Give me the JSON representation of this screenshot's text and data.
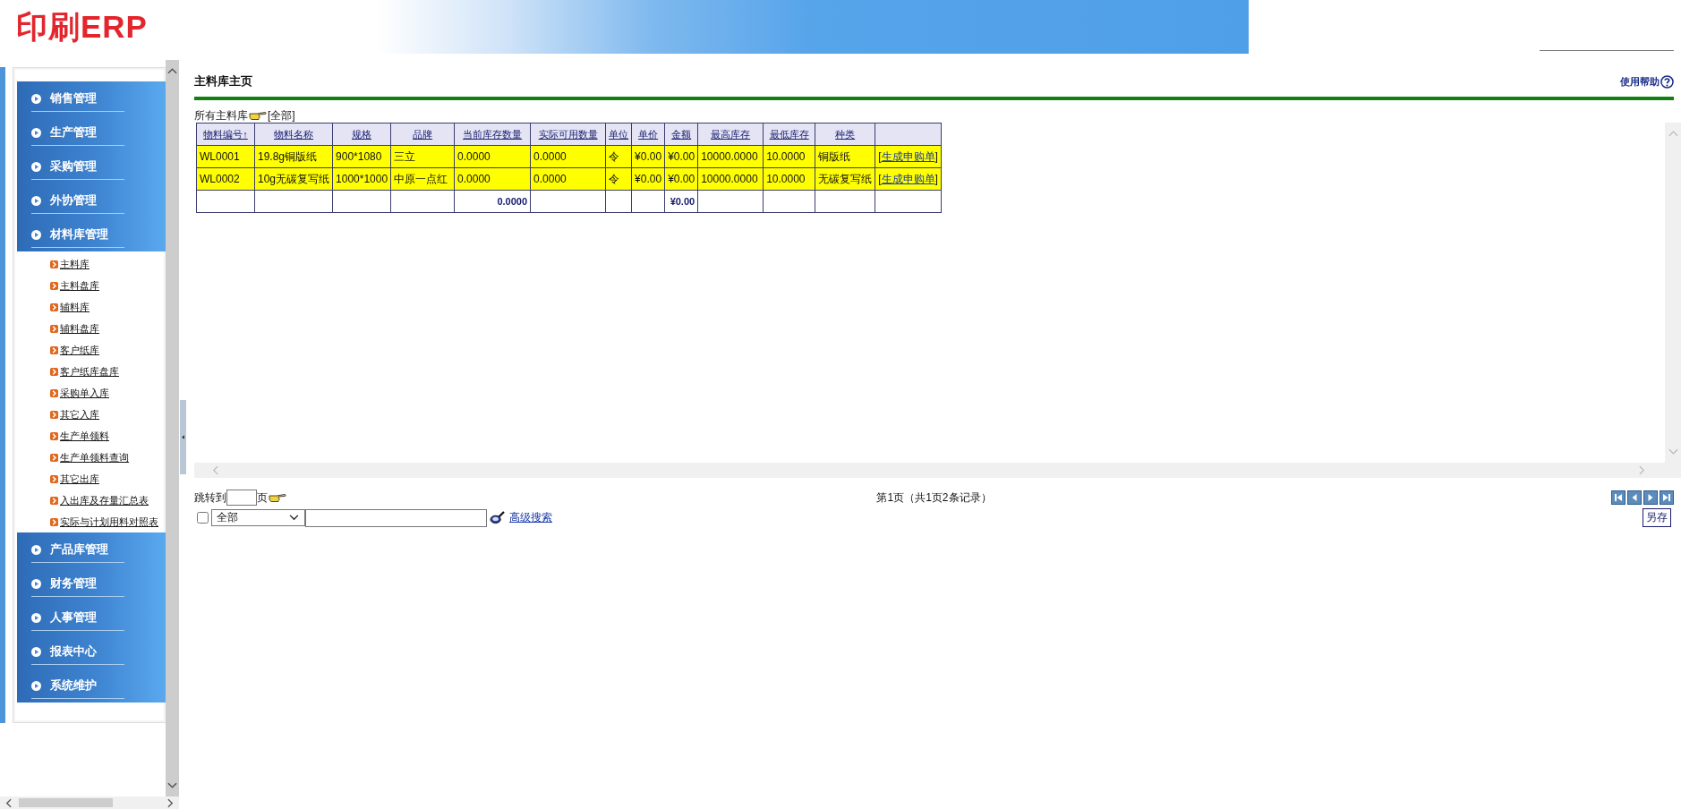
{
  "app": {
    "logo": "印刷ERP"
  },
  "sidebar": {
    "sections": [
      {
        "label": "销售管理"
      },
      {
        "label": "生产管理"
      },
      {
        "label": "采购管理"
      },
      {
        "label": "外协管理"
      },
      {
        "label": "材料库管理",
        "children": [
          {
            "label": "主料库"
          },
          {
            "label": "主料盘库"
          },
          {
            "label": "辅料库"
          },
          {
            "label": "辅料盘库"
          },
          {
            "label": "客户纸库"
          },
          {
            "label": "客户纸库盘库"
          },
          {
            "label": "采购单入库"
          },
          {
            "label": "其它入库"
          },
          {
            "label": "生产单领料"
          },
          {
            "label": "生产单领料查询"
          },
          {
            "label": "其它出库"
          },
          {
            "label": "入出库及存量汇总表"
          },
          {
            "label": "实际与计划用料对照表"
          }
        ]
      },
      {
        "label": "产品库管理"
      },
      {
        "label": "财务管理"
      },
      {
        "label": "人事管理"
      },
      {
        "label": "报表中心"
      },
      {
        "label": "系统维护"
      }
    ]
  },
  "page": {
    "title": "主料库主页",
    "help": "使用帮助"
  },
  "filter": {
    "label": "所有主料库",
    "value": "[全部]"
  },
  "table": {
    "columns": [
      "物料编号↑",
      "物料名称",
      "规格",
      "品牌",
      "当前库存数量",
      "实际可用数量",
      "单位",
      "单价",
      "金额",
      "最高库存",
      "最低库存",
      "种类"
    ],
    "rows": [
      {
        "cells": [
          "WL0001",
          "19.8g铜版纸",
          "900*1080",
          "三立",
          "0.0000",
          "0.0000",
          "令",
          "¥0.00",
          "¥0.00",
          "10000.0000",
          "10.0000",
          "铜版纸"
        ],
        "action": {
          "before": "[",
          "link": "生成申购单",
          "after": "]"
        }
      },
      {
        "cells": [
          "WL0002",
          "10g无碳复写纸",
          "1000*1000",
          "中原一点红",
          "0.0000",
          "0.0000",
          "令",
          "¥0.00",
          "¥0.00",
          "10000.0000",
          "10.0000",
          "无碳复写纸"
        ],
        "action": {
          "before": "[",
          "link": "生成申购单",
          "after": "]"
        }
      }
    ],
    "totals": {
      "current_stock": "0.0000",
      "amount": "¥0.00"
    }
  },
  "pager": {
    "jump_label": "跳转到",
    "jump_unit": "页",
    "info": "第1页（共1页2条记录）"
  },
  "search": {
    "checked": false,
    "field_value": "全部",
    "advanced_link": "高级搜索",
    "save_button": "另存"
  }
}
